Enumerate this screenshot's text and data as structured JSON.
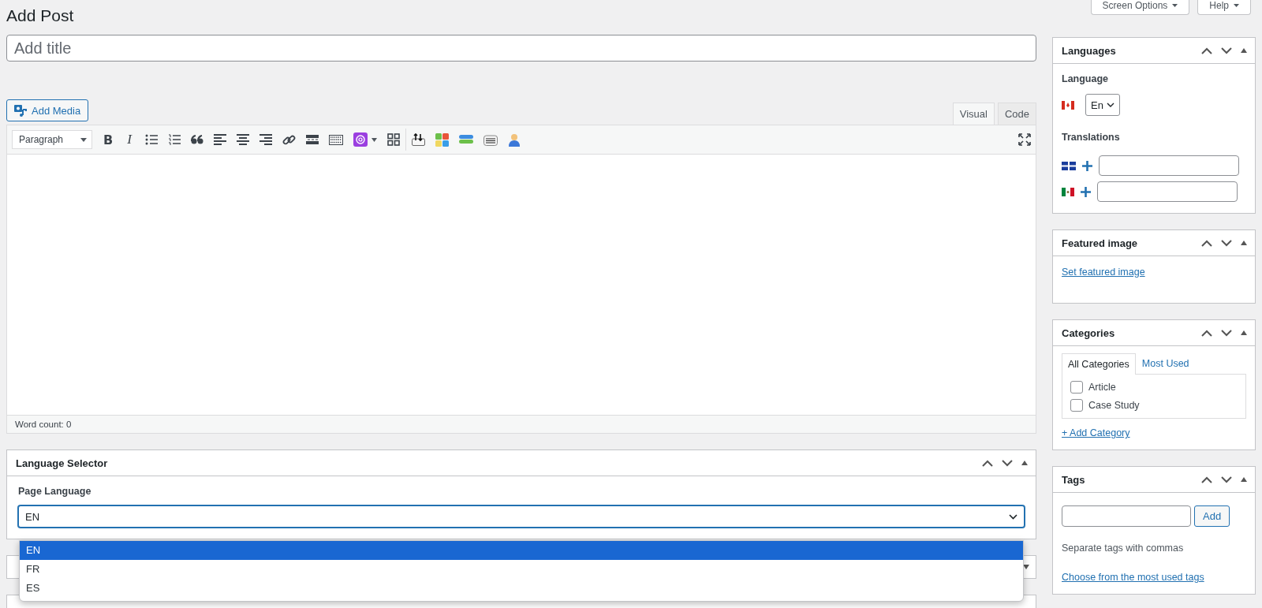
{
  "page_title": "Add Post",
  "screen_meta": [
    {
      "label": "Screen Options"
    },
    {
      "label": "Help"
    }
  ],
  "title_field": {
    "placeholder": "Add title"
  },
  "add_media": {
    "label": "Add Media"
  },
  "editor_tabs": [
    {
      "label": "Visual",
      "selected": true
    },
    {
      "label": "Code",
      "selected": false
    }
  ],
  "toolbar": [
    {
      "kind": "format-select",
      "value": "Paragraph"
    },
    {
      "kind": "bold",
      "label": "B"
    },
    {
      "kind": "italic",
      "label": "I"
    },
    {
      "kind": "bullets"
    },
    {
      "kind": "numbers"
    },
    {
      "kind": "quote"
    },
    {
      "kind": "align-left"
    },
    {
      "kind": "align-center"
    },
    {
      "kind": "align-right"
    },
    {
      "kind": "link"
    },
    {
      "kind": "more"
    },
    {
      "kind": "keyboard"
    },
    {
      "kind": "plugin"
    },
    {
      "kind": "grid"
    },
    {
      "kind": "separator"
    },
    {
      "kind": "upload"
    },
    {
      "kind": "blocks"
    },
    {
      "kind": "bars"
    },
    {
      "kind": "listbox"
    },
    {
      "kind": "user"
    },
    {
      "kind": "spacer"
    },
    {
      "kind": "fullscreen"
    }
  ],
  "word_count": "Word count: 0",
  "language_selector": {
    "title": "Language Selector",
    "label": "Page Language",
    "value": "EN",
    "open": true,
    "options": [
      {
        "label": "EN",
        "selected": true
      },
      {
        "label": "FR",
        "selected": false
      },
      {
        "label": "ES",
        "selected": false
      }
    ]
  },
  "sidebar": {
    "languages": {
      "title": "Languages",
      "language_label": "Language",
      "language_value": "En",
      "translations_label": "Translations"
    },
    "featured_image": {
      "title": "Featured image",
      "link": "Set featured image"
    },
    "categories": {
      "title": "Categories",
      "tabs": [
        {
          "label": "All Categories",
          "selected": true
        },
        {
          "label": "Most Used",
          "selected": false
        }
      ],
      "items": [
        {
          "label": "Article",
          "checked": false
        },
        {
          "label": "Case Study",
          "checked": false
        }
      ],
      "add_link": "+ Add Category"
    },
    "tags": {
      "title": "Tags",
      "button": "Add",
      "hint": "Separate tags with commas",
      "link": "Choose from the most used tags"
    }
  }
}
